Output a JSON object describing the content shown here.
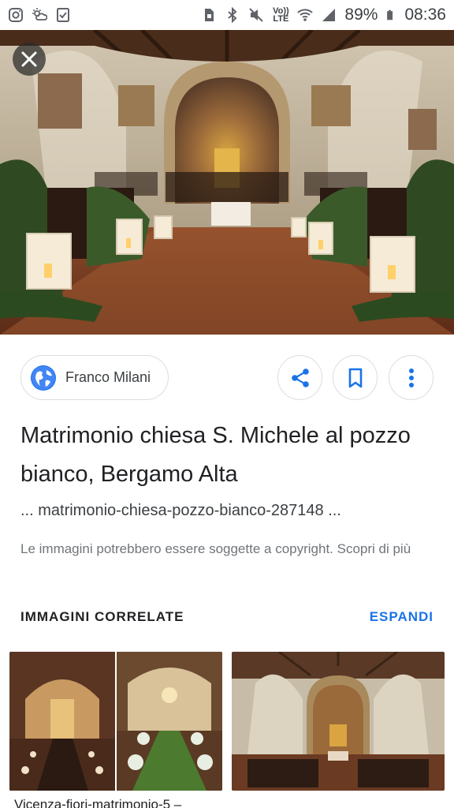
{
  "status_bar": {
    "battery": "89%",
    "time": "08:36",
    "volte": "Vo)) LTE",
    "icons": [
      "instagram-icon",
      "weather-icon",
      "checklist-icon",
      "sim-icon",
      "bluetooth-icon",
      "mute-icon",
      "wifi-icon",
      "signal-icon",
      "battery-icon"
    ]
  },
  "hero": {
    "close_icon": "close-icon"
  },
  "source": {
    "name": "Franco Milani",
    "icon": "globe-icon"
  },
  "actions": {
    "share_icon": "share-icon",
    "bookmark_icon": "bookmark-icon",
    "more_icon": "more-vert-icon"
  },
  "result": {
    "title": "Matrimonio chiesa S. Michele al pozzo bianco, Bergamo Alta",
    "url": "... matrimonio-chiesa-pozzo-bianco-287148 ...",
    "copyright": "Le immagini potrebbero essere soggette a copyright. Scopri di più"
  },
  "related": {
    "heading": "IMMAGINI CORRELATE",
    "expand": "ESPANDI",
    "first_caption": "Vicenza-fiori-matrimonio-5 –"
  },
  "colors": {
    "accent": "#1a73e8",
    "text": "#202124",
    "secondary_text": "#70757a",
    "border": "#dadce0"
  }
}
